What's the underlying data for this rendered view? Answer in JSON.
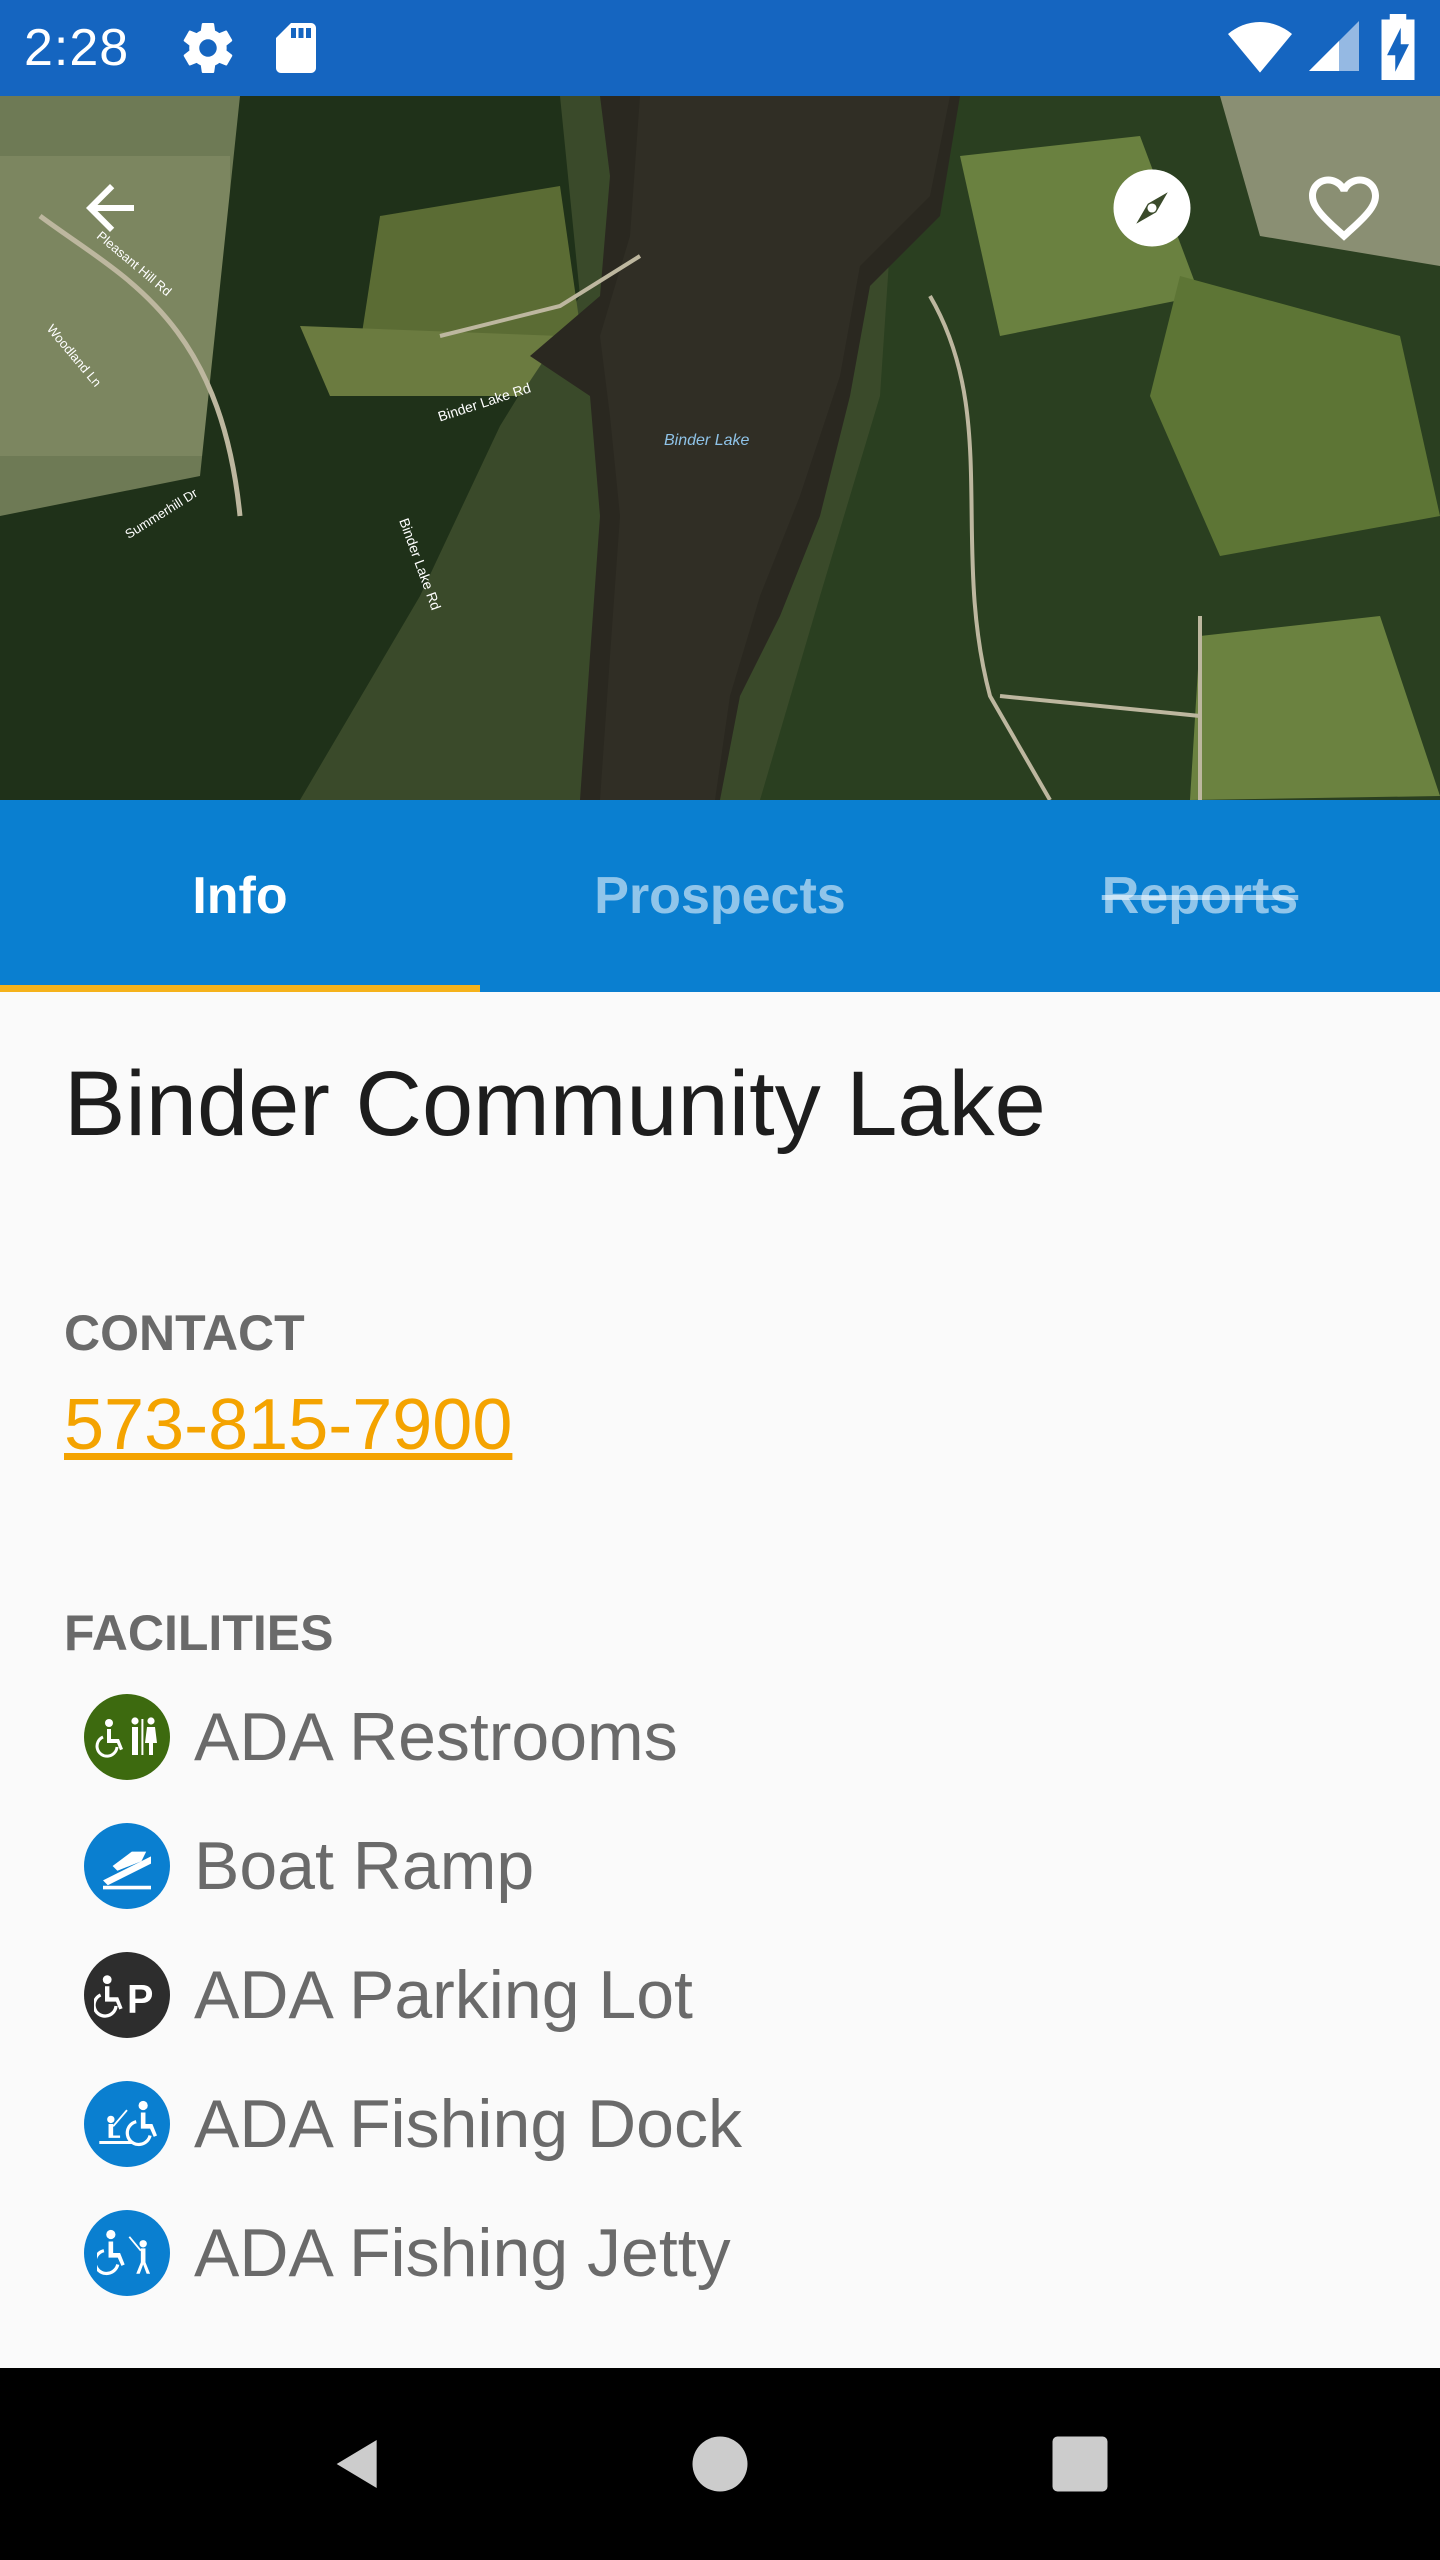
{
  "status_bar": {
    "time": "2:28",
    "icons": [
      "settings-icon",
      "sd-card-icon",
      "wifi-icon",
      "signal-icon",
      "battery-charging-icon"
    ]
  },
  "map": {
    "labels": {
      "lake": "Binder Lake",
      "road_1": "Binder Lake Rd",
      "road_2": "Binder Lake Rd",
      "road_3": "Summerhill Dr",
      "road_4": "Pleasant Hill Rd",
      "road_5": "Woodland Ln"
    },
    "buttons": {
      "back": "back-arrow-icon",
      "compass": "compass-icon",
      "favorite": "heart-icon"
    }
  },
  "tabs": [
    {
      "label": "Info",
      "active": true
    },
    {
      "label": "Prospects",
      "active": false
    },
    {
      "label": "Reports",
      "active": false
    }
  ],
  "lake": {
    "name": "Binder Community Lake",
    "contact_label": "CONTACT",
    "phone": "573-815-7900",
    "facilities_label": "FACILITIES",
    "facilities": [
      {
        "label": "ADA Restrooms",
        "icon": "ada-restroom-icon",
        "color": "#3d6a0f"
      },
      {
        "label": "Boat Ramp",
        "icon": "boat-ramp-icon",
        "color": "#0a7fd0"
      },
      {
        "label": "ADA Parking Lot",
        "icon": "ada-parking-icon",
        "color": "#2d2d2d"
      },
      {
        "label": "ADA Fishing Dock",
        "icon": "ada-fishing-dock-icon",
        "color": "#0a7fd0"
      },
      {
        "label": "ADA Fishing Jetty",
        "icon": "ada-fishing-jetty-icon",
        "color": "#0a7fd0"
      }
    ]
  },
  "colors": {
    "primary": "#0a7fd0",
    "status_bar": "#1565c0",
    "accent": "#f5b21b",
    "link": "#f4a300"
  }
}
